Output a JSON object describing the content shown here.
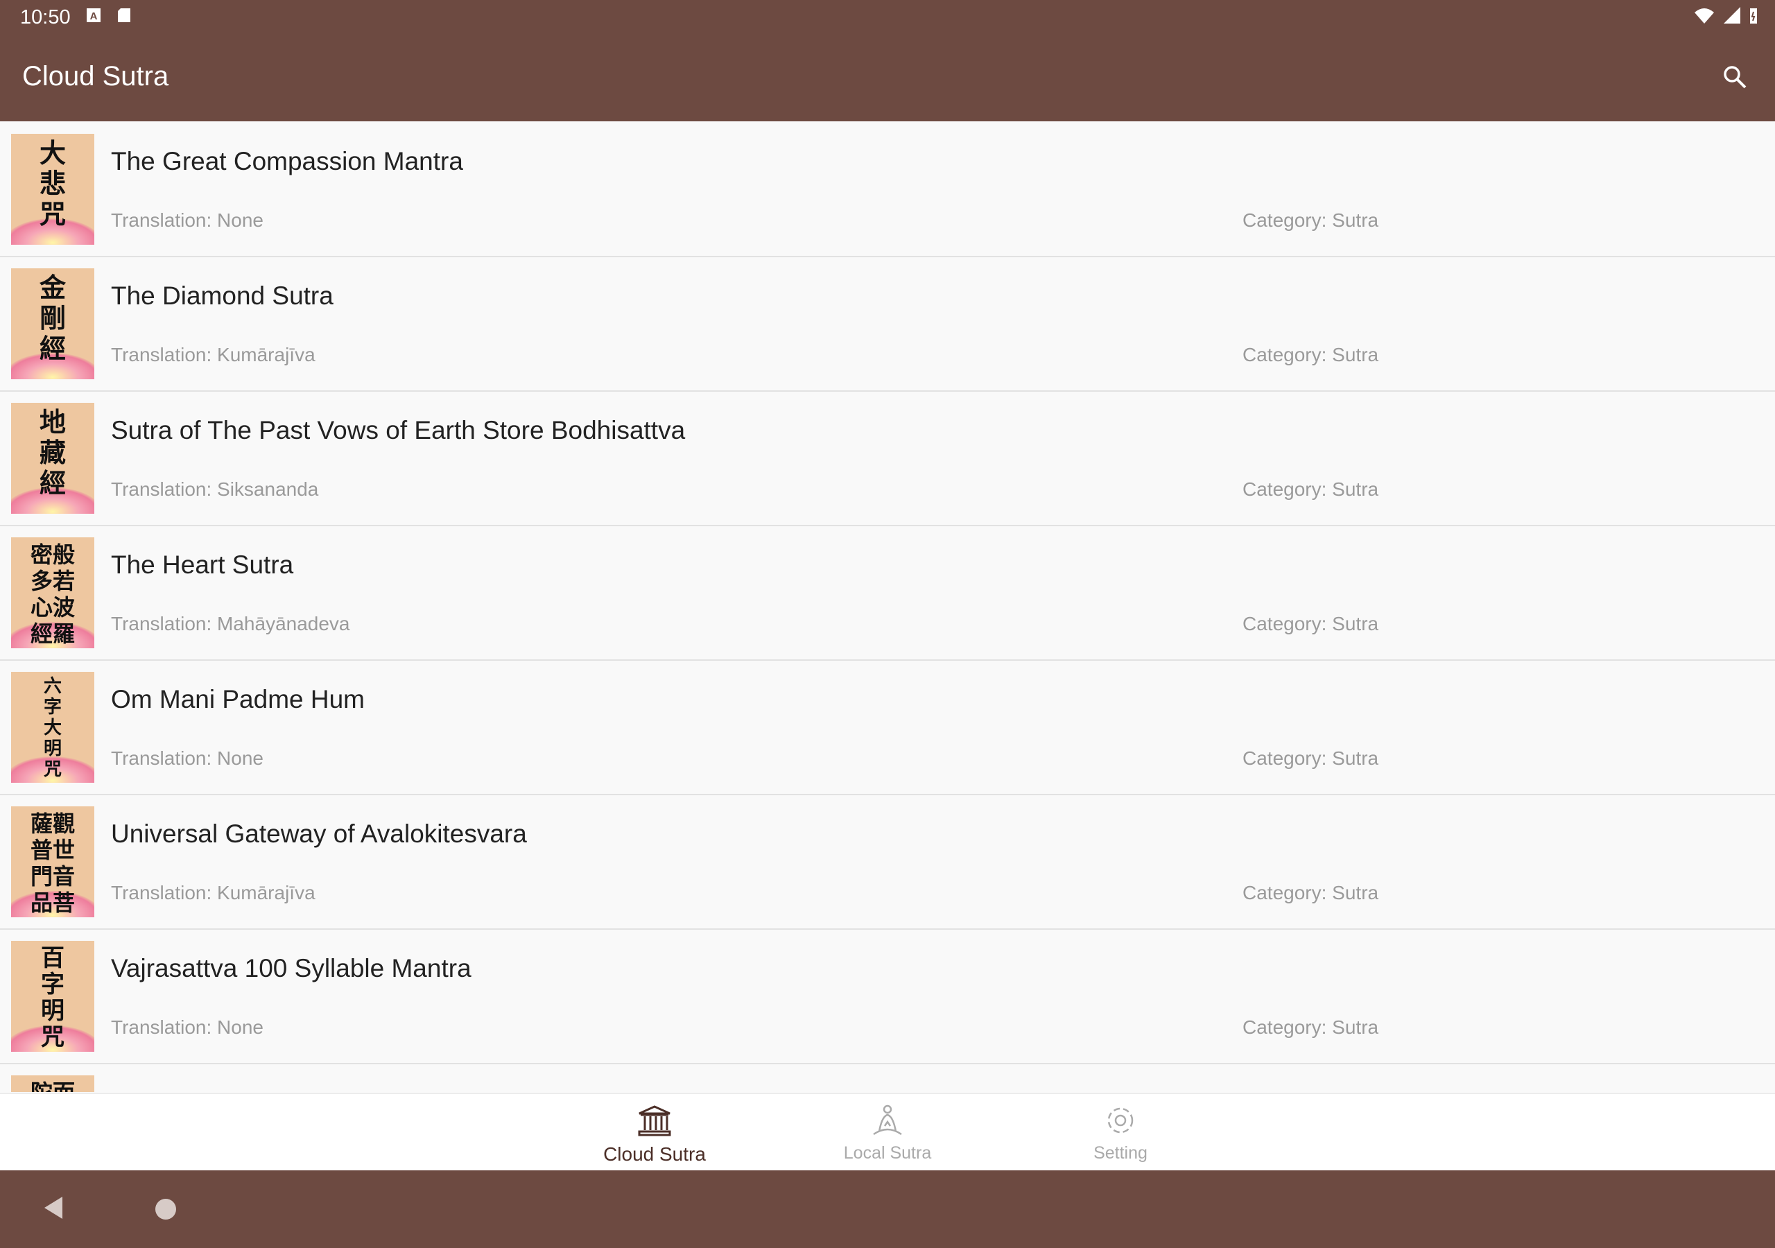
{
  "status_bar": {
    "time": "10:50"
  },
  "app_bar": {
    "title": "Cloud Sutra",
    "search_icon": "search-icon"
  },
  "sutras": [
    {
      "title": "The Great Compassion Mantra",
      "translation": "Translation: None",
      "category": "Category: Sutra",
      "cover_text": "大\n悲\n咒"
    },
    {
      "title": "The Diamond Sutra",
      "translation": "Translation: Kumārajīva",
      "category": "Category: Sutra",
      "cover_text": "金\n剛\n經"
    },
    {
      "title": "Sutra of The Past Vows of Earth Store Bodhisattva",
      "translation": "Translation: Siksananda",
      "category": "Category: Sutra",
      "cover_text": "地\n藏\n經"
    },
    {
      "title": "The Heart Sutra",
      "translation": "Translation: Mahāyānadeva",
      "category": "Category: Sutra",
      "cover_text": "密般\n多若\n心波\n經羅"
    },
    {
      "title": "Om Mani Padme Hum",
      "translation": "Translation: None",
      "category": "Category: Sutra",
      "cover_text": "六\n字\n大\n明\n咒"
    },
    {
      "title": "Universal Gateway of Avalokitesvara",
      "translation": "Translation: Kumārajīva",
      "category": "Category: Sutra",
      "cover_text": "薩觀\n普世\n門音\n品菩"
    },
    {
      "title": "Vajrasattva 100 Syllable Mantra",
      "translation": "Translation: None",
      "category": "Category: Sutra",
      "cover_text": "百\n字\n明\n咒"
    },
    {
      "title": "",
      "translation": "",
      "category": "",
      "cover_text": "陀而"
    }
  ],
  "bottom_nav": [
    {
      "label": "Cloud Sutra",
      "icon": "temple-icon",
      "active": true
    },
    {
      "label": "Local Sutra",
      "icon": "meditation-icon",
      "active": false
    },
    {
      "label": "Setting",
      "icon": "gear-icon",
      "active": false
    }
  ],
  "colors": {
    "primary": "#6d4a41",
    "active_nav": "#4b2e27",
    "muted_text": "#9a9a9a"
  }
}
